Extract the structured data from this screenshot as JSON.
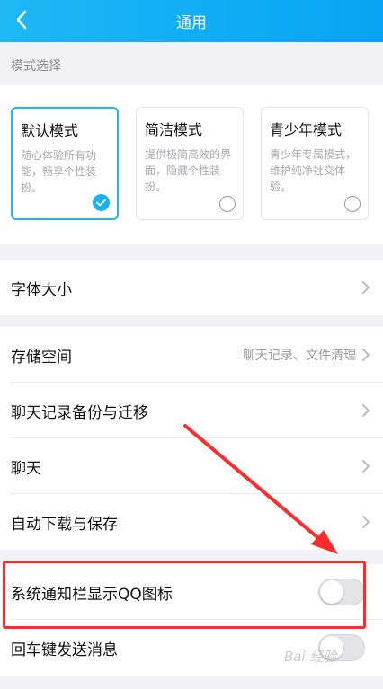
{
  "header": {
    "title": "通用"
  },
  "modes": {
    "section_label": "模式选择",
    "items": [
      {
        "title": "默认模式",
        "description": "随心体验所有功能，畅享个性装扮。",
        "selected": true
      },
      {
        "title": "简洁模式",
        "description": "提供极简高效的界面，隐藏个性装扮。",
        "selected": false
      },
      {
        "title": "青少年模式",
        "description": "青少年专属模式，维护纯净社交体验。",
        "selected": false
      }
    ]
  },
  "settings": {
    "font_size": "字体大小",
    "storage": {
      "label": "存储空间",
      "value": "聊天记录、文件清理"
    },
    "chat_backup": "聊天记录备份与迁移",
    "chat": "聊天",
    "auto_download": "自动下载与保存",
    "notify_icon": {
      "label": "系统通知栏显示QQ图标",
      "enabled": false
    },
    "enter_send": {
      "label": "回车键发送消息",
      "enabled": false
    }
  },
  "watermark": "Bai 经验",
  "colors": {
    "accent": "#18b2f2",
    "annotation": "#ff2a2a"
  }
}
